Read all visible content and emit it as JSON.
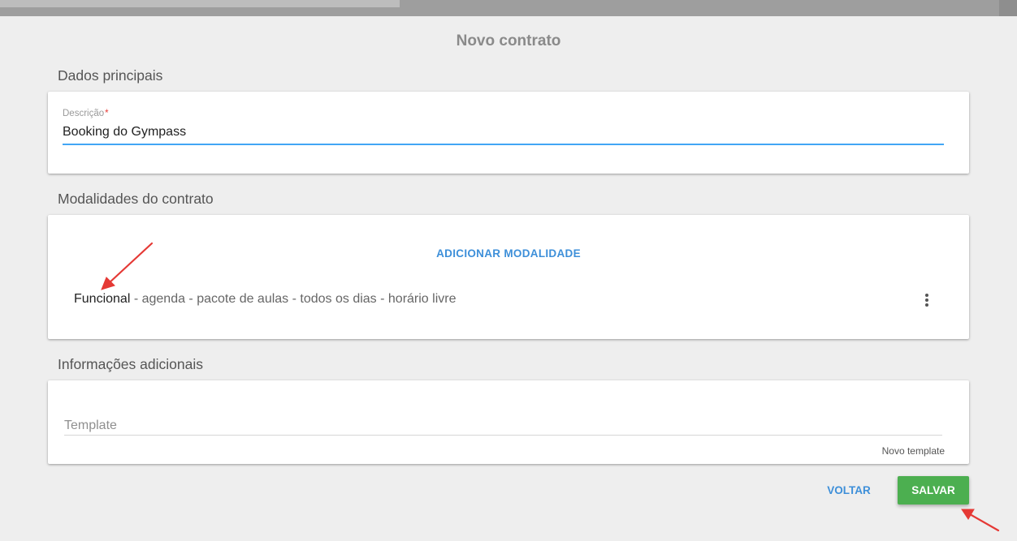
{
  "page": {
    "title": "Novo contrato"
  },
  "sections": {
    "main": {
      "title": "Dados principais",
      "description_label": "Descrição",
      "required_mark": "*",
      "description_value": "Booking do Gympass"
    },
    "modalities": {
      "title": "Modalidades do contrato",
      "add_button": "ADICIONAR MODALIDADE",
      "items": [
        {
          "name": "Funcional",
          "details": " - agenda - pacote de aulas - todos os dias - horário livre"
        }
      ]
    },
    "additional": {
      "title": "Informações adicionais",
      "template_placeholder": "Template",
      "new_template_link": "Novo template"
    }
  },
  "actions": {
    "back": "VOLTAR",
    "save": "SALVAR"
  },
  "colors": {
    "accent": "#3d8fd9",
    "save": "#4caf50",
    "annotation": "#e53935"
  }
}
